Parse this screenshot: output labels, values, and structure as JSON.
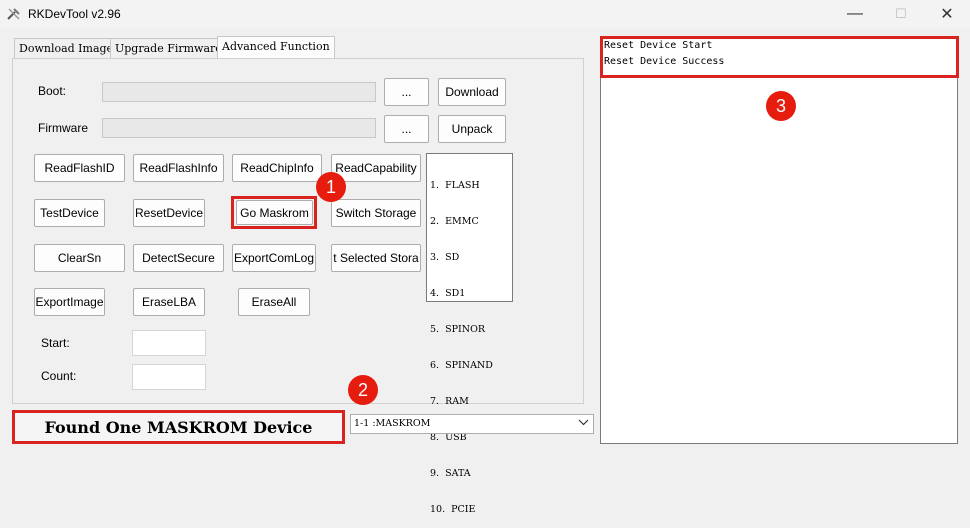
{
  "window": {
    "title": "RKDevTool v2.96",
    "minimize_glyph": "—",
    "maximize_glyph": "☐",
    "close_glyph": "✕"
  },
  "tabs": [
    {
      "label": "Download Image",
      "active": false
    },
    {
      "label": "Upgrade Firmware",
      "active": false
    },
    {
      "label": "Advanced Function",
      "active": true
    }
  ],
  "advanced": {
    "boot_label": "Boot:",
    "firmware_label": "Firmware",
    "browse_label": "...",
    "download_label": "Download",
    "unpack_label": "Unpack",
    "buttons": {
      "read_flash_id": "ReadFlashID",
      "read_flash_info": "ReadFlashInfo",
      "read_chip_info": "ReadChipInfo",
      "read_capability": "ReadCapability",
      "test_device": "TestDevice",
      "reset_device": "ResetDevice",
      "go_maskrom": "Go Maskrom",
      "switch_storage": "Switch Storage",
      "clear_sn": "ClearSn",
      "detect_secure": "DetectSecure",
      "export_com_log": "ExportComLog",
      "export_selected_storage": "t Selected Stora",
      "export_image": "ExportImage",
      "erase_lba": "EraseLBA",
      "erase_all": "EraseAll"
    },
    "storage_list": [
      "1.  FLASH",
      "2.  EMMC",
      "3.  SD",
      "4.  SD1",
      "5.  SPINOR",
      "6.  SPINAND",
      "7.  RAM",
      "8.  USB",
      "9.  SATA",
      "10.  PCIE"
    ],
    "start_label": "Start:",
    "count_label": "Count:"
  },
  "status": {
    "message": "Found One MASKROM Device",
    "device_selected": "1-1 :MASKROM"
  },
  "log": {
    "lines": [
      "Reset Device Start",
      "Reset Device Success"
    ]
  },
  "annotations": {
    "marker_1": "1",
    "marker_2": "2",
    "marker_3": "3",
    "color": "#e51c0e"
  }
}
